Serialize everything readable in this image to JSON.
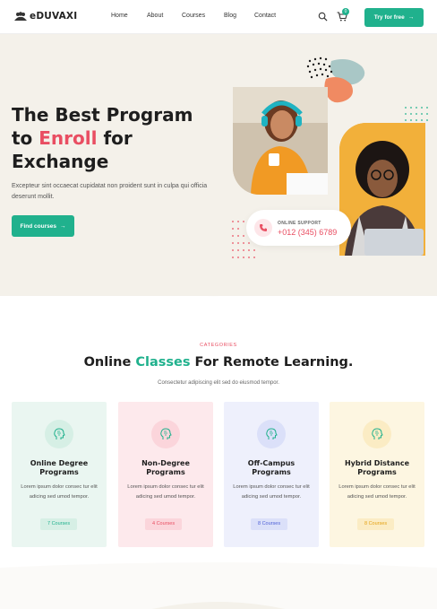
{
  "brand": {
    "name": "eDUVAXI"
  },
  "nav": {
    "links": [
      "Home",
      "About",
      "Courses",
      "Blog",
      "Contact"
    ],
    "cart_count": "0",
    "cta_label": "Try for free"
  },
  "hero": {
    "title_prefix": "The Best Program to ",
    "title_accent": "Enroll",
    "title_suffix": " for Exchange",
    "description": "Excepteur sint occaecat cupidatat non proident sunt in culpa qui officia deserunt mollit.",
    "button_label": "Find courses",
    "support_label": "ONLINE SUPPORT",
    "support_phone": "+012 (345) 6789"
  },
  "categories": {
    "eyebrow": "CATEGORIES",
    "title_prefix": "Online ",
    "title_accent": "Classes",
    "title_suffix": " For Remote Learning.",
    "subtitle": "Consectetur adipiscing elit sed do eiusmod tempor.",
    "items": [
      {
        "title_line1": "Online Degree",
        "title_line2": "Programs",
        "desc": "Lorem ipsum dolor consec tur elit adicing sed umod tempor.",
        "count": "7 Courses"
      },
      {
        "title_line1": "Non-Degree",
        "title_line2": "Programs",
        "desc": "Lorem ipsum dolor consec tur elit adicing sed umod tempor.",
        "count": "4 Courses"
      },
      {
        "title_line1": "Off-Campus",
        "title_line2": "Programs",
        "desc": "Lorem ipsum dolor consec tur elit adicing sed umod tempor.",
        "count": "8 Courses"
      },
      {
        "title_line1": "Hybrid Distance",
        "title_line2": "Programs",
        "desc": "Lorem ipsum dolor consec tur elit adicing sed umod tempor.",
        "count": "8 Courses"
      }
    ]
  },
  "colors": {
    "primary": "#20b18d",
    "accent": "#e94e62",
    "hero_bg": "#f4f1ea"
  }
}
